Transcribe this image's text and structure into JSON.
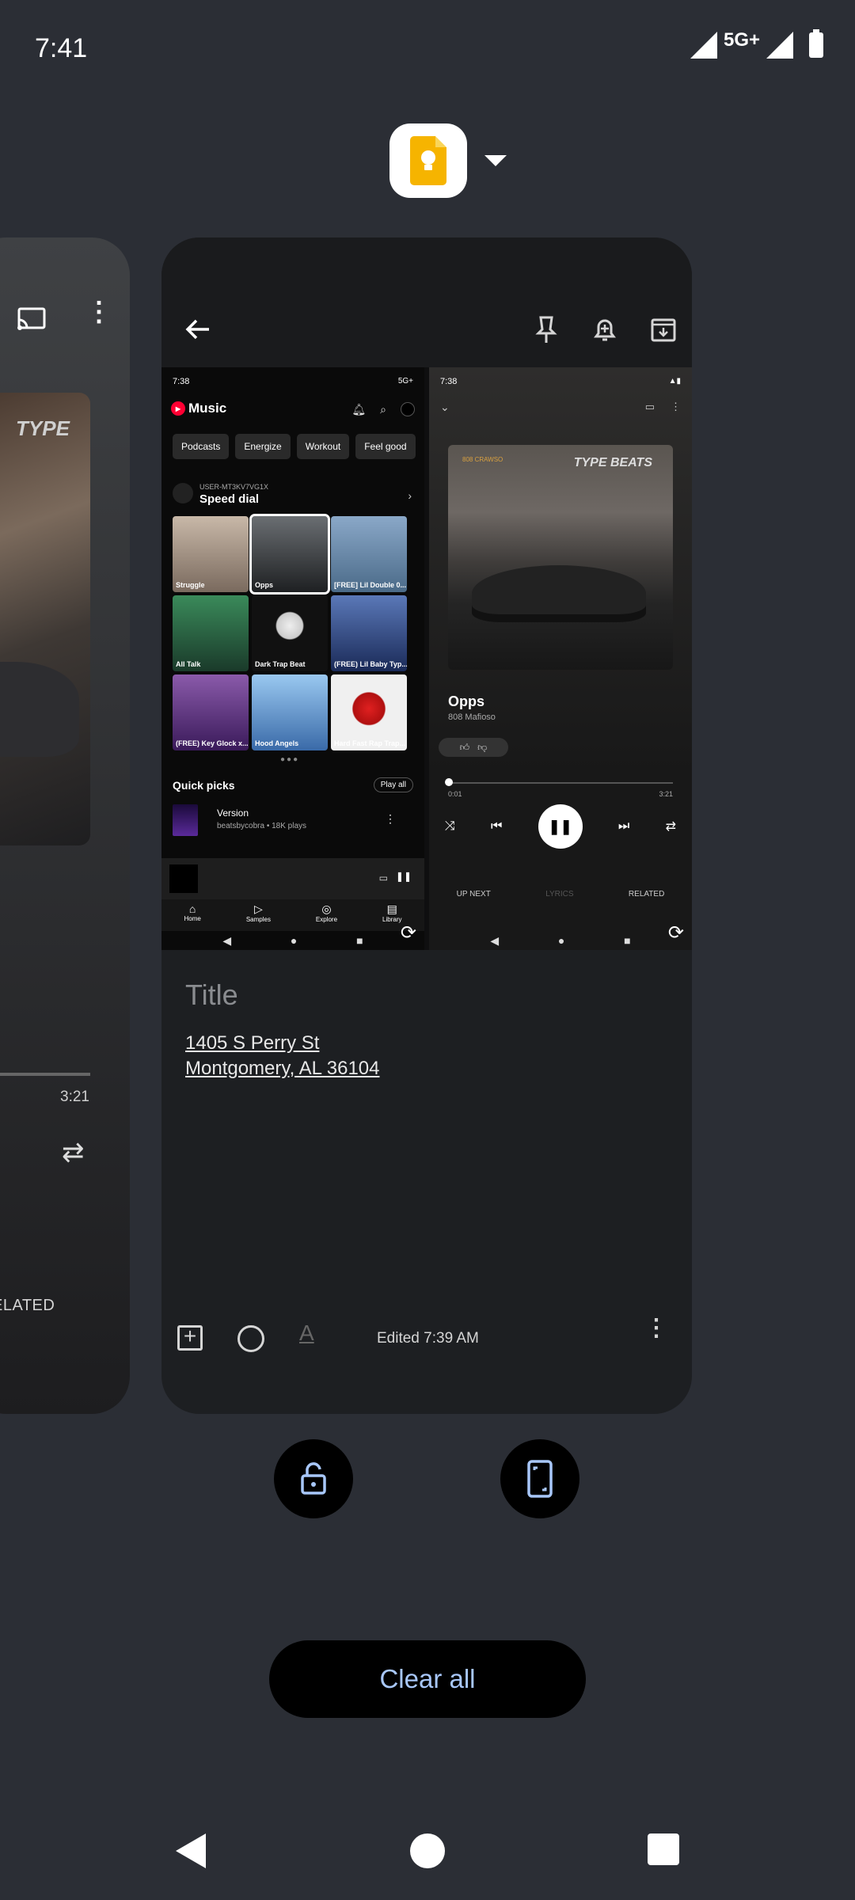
{
  "status_bar": {
    "time": "7:41",
    "network": "5G+"
  },
  "recents": {
    "app_name_icon": "google-keep-icon",
    "left_card": {
      "time": "3:21",
      "tab_label": "ELATED"
    },
    "main_card": {
      "screenshot_music": {
        "status_time": "7:38",
        "status_icons": "5G+",
        "app_title": "Music",
        "chips": [
          "Podcasts",
          "Energize",
          "Workout",
          "Feel good"
        ],
        "speed_dial_user": "USER-MT3KV7VG1X",
        "speed_dial_title": "Speed dial",
        "tiles": [
          {
            "label": "Struggle",
            "color": "#9b8a7e"
          },
          {
            "label": "Opps",
            "color": "#3a3d40"
          },
          {
            "label": "[FREE] Lil Double 0...",
            "color": "#6a8aa8"
          },
          {
            "label": "All Talk",
            "color": "#2d6a4a"
          },
          {
            "label": "Dark Trap Beat",
            "color": "#1a1a1a"
          },
          {
            "label": "(FREE) Lil Baby Typ...",
            "color": "#34508a"
          },
          {
            "label": "(FREE) Key Glock x...",
            "color": "#6a3a8a"
          },
          {
            "label": "Hood Angels",
            "color": "#3a7ab8"
          },
          {
            "label": "Hard Fast Rap Trap...",
            "color": "#b81a1a"
          }
        ],
        "quick_picks": "Quick picks",
        "play_all": "Play all",
        "song": "Version",
        "song_meta": "beatsbycobra • 18K plays",
        "nav": [
          "Home",
          "Samples",
          "Explore",
          "Library"
        ]
      },
      "screenshot_player": {
        "status_time": "7:38",
        "art_logo": "TYPE BEATS",
        "art_tag": "808 CRAWSO",
        "song_title": "Opps",
        "artist": "808 Mafioso",
        "time_elapsed": "0:01",
        "time_total": "3:21",
        "tabs": [
          "UP NEXT",
          "LYRICS",
          "RELATED"
        ]
      },
      "note": {
        "title_placeholder": "Title",
        "address_line1": "1405 S Perry St ",
        "address_line2": "Montgomery, AL 36104"
      },
      "toolbar": {
        "edited": "Edited 7:39 AM"
      }
    }
  },
  "clear_all_label": "Clear all"
}
